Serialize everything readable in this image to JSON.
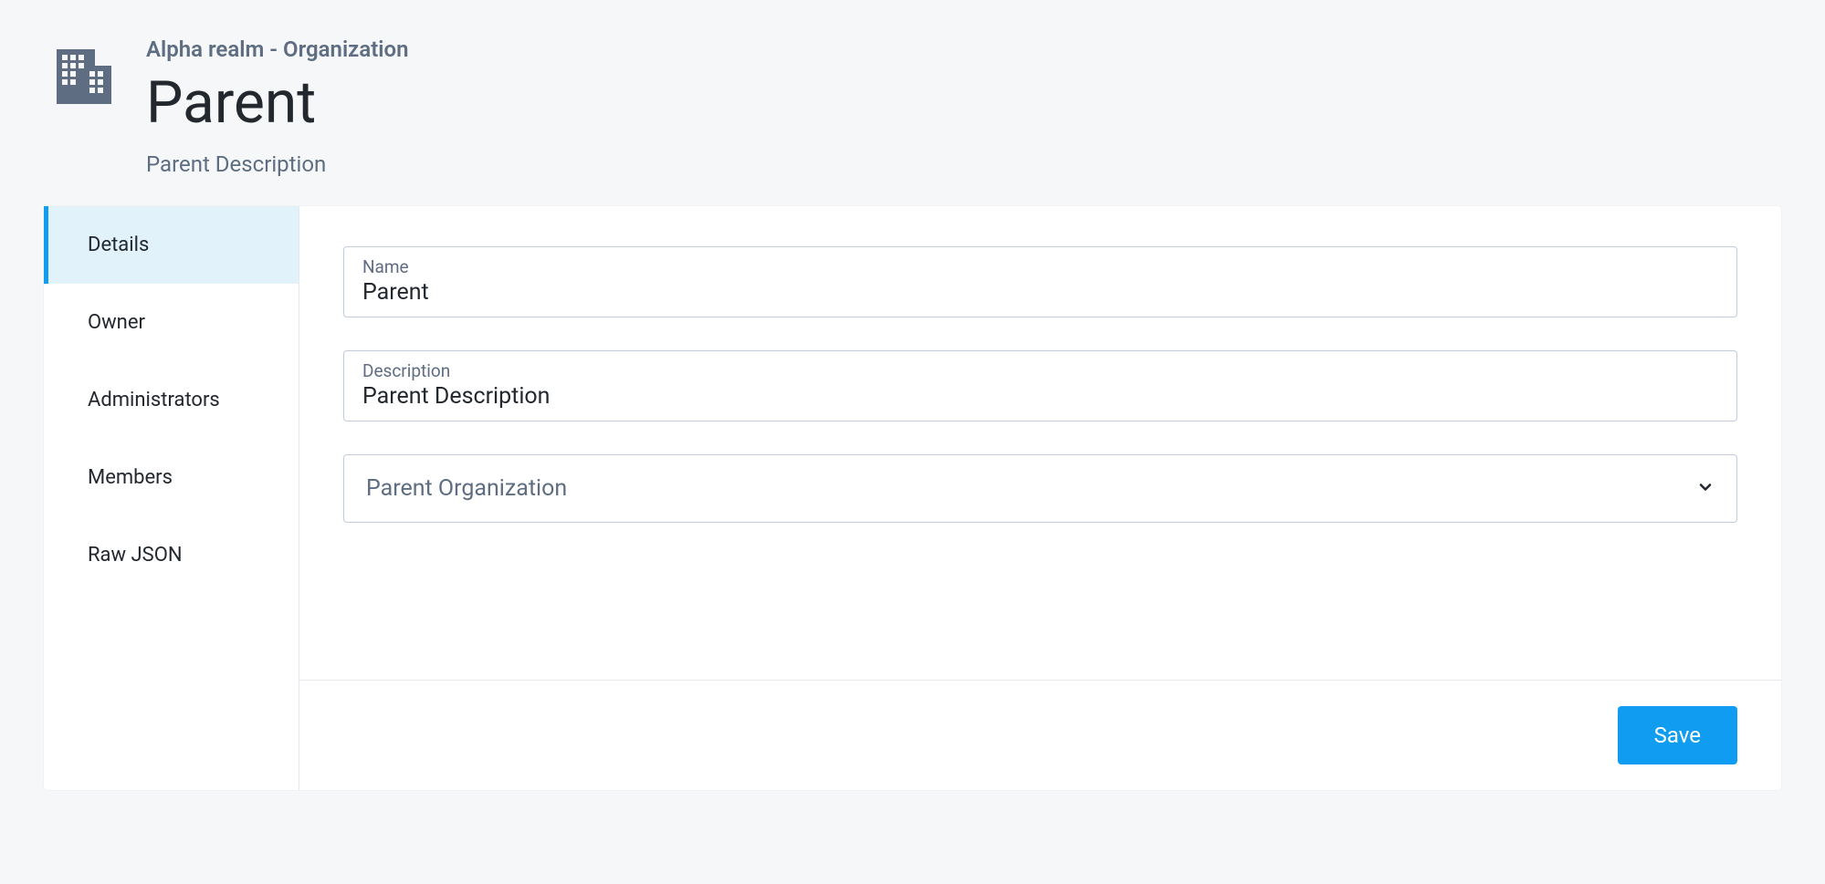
{
  "header": {
    "breadcrumb": "Alpha realm - Organization",
    "title": "Parent",
    "subtitle": "Parent Description"
  },
  "tabs": [
    {
      "label": "Details",
      "active": true
    },
    {
      "label": "Owner",
      "active": false
    },
    {
      "label": "Administrators",
      "active": false
    },
    {
      "label": "Members",
      "active": false
    },
    {
      "label": "Raw JSON",
      "active": false
    }
  ],
  "form": {
    "name": {
      "label": "Name",
      "value": "Parent"
    },
    "description": {
      "label": "Description",
      "value": "Parent Description"
    },
    "parentOrg": {
      "placeholder": "Parent Organization"
    }
  },
  "actions": {
    "save": "Save"
  }
}
